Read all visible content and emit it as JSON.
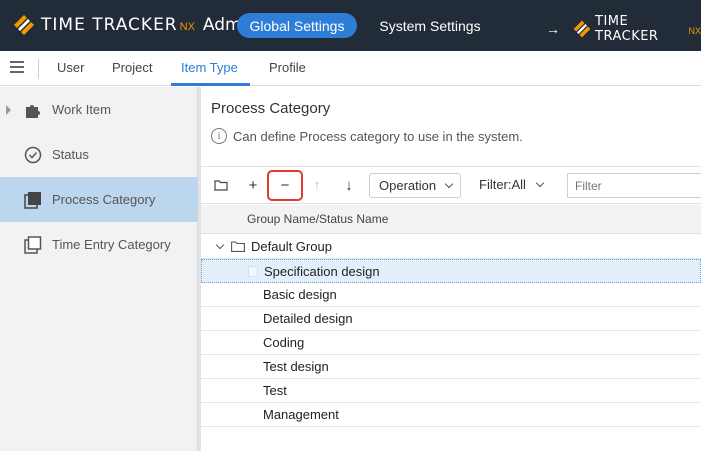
{
  "header": {
    "logo_text": "TIME TRACKER",
    "logo_suffix": "NX",
    "logo_admin": "Admin",
    "global_settings_label": "Global Settings",
    "system_settings_label": "System Settings",
    "switch_arrow": "→",
    "logo2_text": "TIME TRACKER",
    "logo2_suffix": "NX",
    "accent_color": "#f39800",
    "active_button_color": "#2e7dd7"
  },
  "tabs": {
    "menu_icon": "hamburger-icon",
    "items": [
      {
        "label": "User",
        "active": false
      },
      {
        "label": "Project",
        "active": false
      },
      {
        "label": "Item Type",
        "active": true
      },
      {
        "label": "Profile",
        "active": false
      }
    ]
  },
  "sidebar": {
    "items": [
      {
        "label": "Work Item",
        "icon": "puzzle-icon",
        "active": false,
        "expandable": true
      },
      {
        "label": "Status",
        "icon": "check-circle-icon",
        "active": false
      },
      {
        "label": "Process Category",
        "icon": "stacked-squares-icon",
        "active": true
      },
      {
        "label": "Time Entry Category",
        "icon": "stacked-squares-outline-icon",
        "active": false
      }
    ]
  },
  "main": {
    "title": "Process Category",
    "info_icon_glyph": "i",
    "info_text": "Can define Process category to use in the system.",
    "toolbar": {
      "add_folder_icon": "folder-icon",
      "add_glyph": "+",
      "remove_glyph": "−",
      "move_up_glyph": "↑",
      "move_down_glyph": "↓",
      "operation_label": "Operation",
      "filter_label": "Filter:All",
      "filter_placeholder": "Filter"
    },
    "grid": {
      "column_header": "Group Name/Status Name",
      "group": {
        "label": "Default Group",
        "expanded": true
      },
      "rows": [
        {
          "label": "Specification design",
          "selected": true
        },
        {
          "label": "Basic design",
          "selected": false
        },
        {
          "label": "Detailed design",
          "selected": false
        },
        {
          "label": "Coding",
          "selected": false
        },
        {
          "label": "Test design",
          "selected": false
        },
        {
          "label": "Test",
          "selected": false
        },
        {
          "label": "Management",
          "selected": false
        }
      ]
    }
  }
}
